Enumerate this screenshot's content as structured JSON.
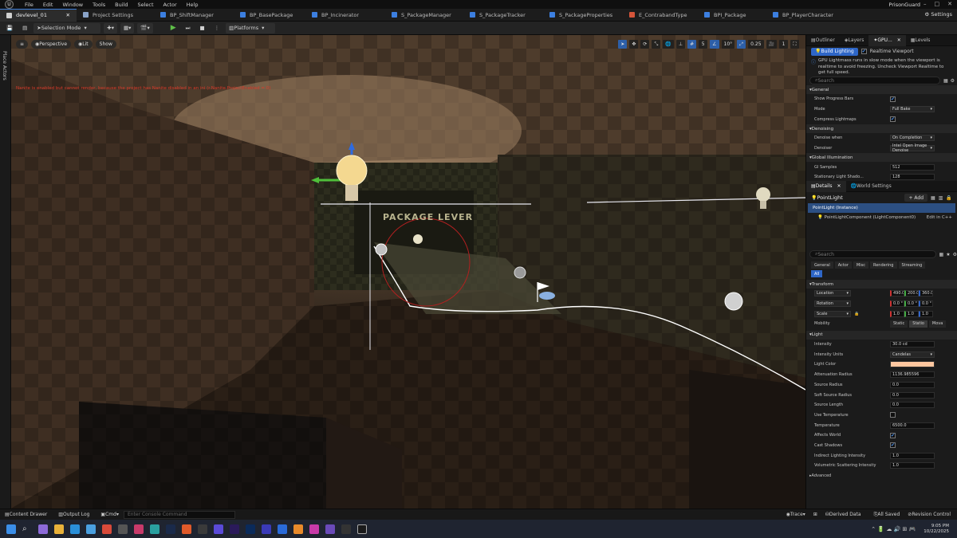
{
  "menubar": {
    "logo": "U",
    "items": [
      "File",
      "Edit",
      "Window",
      "Tools",
      "Build",
      "Select",
      "Actor",
      "Help"
    ],
    "project": "PrisonGuard"
  },
  "tabs": [
    {
      "label": "devlevel_01",
      "color": "#d0d0d0"
    },
    {
      "label": "Project Settings",
      "color": "#8aa3c8"
    },
    {
      "label": "BP_ShiftManager",
      "color": "#3c7fe0"
    },
    {
      "label": "BP_BasePackage",
      "color": "#3c7fe0"
    },
    {
      "label": "BP_Incinerator",
      "color": "#3c7fe0"
    },
    {
      "label": "S_PackageManager",
      "color": "#3c7fe0"
    },
    {
      "label": "S_PackageTracker",
      "color": "#3c7fe0"
    },
    {
      "label": "S_PackageProperties",
      "color": "#3c7fe0"
    },
    {
      "label": "E_ContrabandType",
      "color": "#d6553a"
    },
    {
      "label": "BPI_Package",
      "color": "#3c7fe0"
    },
    {
      "label": "BP_PlayerCharacter",
      "color": "#3c7fe0"
    }
  ],
  "tabbar": {
    "settings": "Settings"
  },
  "toolbar": {
    "selection_mode": "Selection Mode",
    "platforms": "Platforms"
  },
  "place_actors": "Place Actors",
  "viewport": {
    "perspective": "Perspective",
    "lit": "Lit",
    "show": "Show",
    "nanite_warning": "Nanite is enabled but cannot render, because the project has Nanite disabled in an ini (r.Nanite.ProjectEnabled = 0)",
    "sign_text": "PACKAGE LEVER",
    "grid_snap": "5",
    "rot_snap": "10°",
    "scale_snap": "0.25",
    "cam_speed": "1"
  },
  "top_panel": {
    "tabs": [
      "Outliner",
      "Layers",
      "GPU...",
      "Levels"
    ],
    "build_lighting": "Build Lighting",
    "realtime_viewport": "Realtime Viewport",
    "info": "GPU Lightmass runs in slow mode when the viewport is realtime to avoid freezing. Uncheck Viewport Realtime to get full speed.",
    "search": "Search",
    "sections": [
      {
        "title": "General",
        "props": [
          {
            "label": "Show Progress Bars",
            "value": "",
            "type": "check"
          },
          {
            "label": "Mode",
            "value": "Full Bake",
            "type": "dd"
          },
          {
            "label": "Compress Lightmaps",
            "value": "",
            "type": "check"
          }
        ]
      },
      {
        "title": "Denoising",
        "props": [
          {
            "label": "Denoise when",
            "value": "On Completion",
            "type": "dd"
          },
          {
            "label": "Denoiser",
            "value": "Intel Open Image Denoise",
            "type": "dd"
          }
        ]
      },
      {
        "title": "Global Illumination",
        "props": [
          {
            "label": "GI Samples",
            "value": "512",
            "type": "field"
          },
          {
            "label": "Stationary Light Shado...",
            "value": "128",
            "type": "field"
          }
        ]
      }
    ]
  },
  "details": {
    "tabs": [
      "Details",
      "World Settings"
    ],
    "actor": "PointLight",
    "add": "+ Add",
    "instance": "PointLight (Instance)",
    "component": "PointLightComponent (LightComponent0)",
    "edit_cpp": "Edit in C++",
    "search": "Search",
    "categories": [
      "General",
      "Actor",
      "Misc",
      "Rendering",
      "Streaming",
      "All"
    ],
    "transform_title": "Transform",
    "location_label": "Location",
    "location": [
      "490.0",
      "200.0",
      "360.0"
    ],
    "rotation_label": "Rotation",
    "rotation": [
      "0.0 °",
      "0.0 °",
      "0.0 °"
    ],
    "scale_label": "Scale",
    "scale": [
      "1.0",
      "1.0",
      "1.0"
    ],
    "mobility_label": "Mobility",
    "mobility": [
      "Static",
      "Statio",
      "Movа"
    ],
    "light_title": "Light",
    "light_props": [
      {
        "label": "Intensity",
        "value": "30.0 cd",
        "type": "field"
      },
      {
        "label": "Intensity Units",
        "value": "Candelas",
        "type": "dd"
      },
      {
        "label": "Light Color",
        "value": "",
        "type": "color"
      },
      {
        "label": "Attenuation Radius",
        "value": "1136.985596",
        "type": "field"
      },
      {
        "label": "Source Radius",
        "value": "0.0",
        "type": "field"
      },
      {
        "label": "Soft Source Radius",
        "value": "0.0",
        "type": "field"
      },
      {
        "label": "Source Length",
        "value": "0.0",
        "type": "field"
      },
      {
        "label": "Use Temperature",
        "value": "",
        "type": "uncheck"
      },
      {
        "label": "Temperature",
        "value": "6500.0",
        "type": "field"
      },
      {
        "label": "Affects World",
        "value": "",
        "type": "check"
      },
      {
        "label": "Cast Shadows",
        "value": "",
        "type": "check"
      },
      {
        "label": "Indirect Lighting Intensity",
        "value": "1.0",
        "type": "field"
      },
      {
        "label": "Volumetric Scattering Intensity",
        "value": "1.0",
        "type": "field"
      }
    ],
    "advanced": "Advanced",
    "light_color_hex": "#ffc7a0"
  },
  "bottombar": {
    "content_drawer": "Content Drawer",
    "output_log": "Output Log",
    "cmd": "Cmd",
    "console_placeholder": "Enter Console Command",
    "trace": "Trace",
    "derived_data": "Derived Data",
    "all_saved": "All Saved",
    "revision_control": "Revision Control"
  },
  "taskbar": {
    "time": "9:05 PM",
    "date": "10/22/2025"
  }
}
